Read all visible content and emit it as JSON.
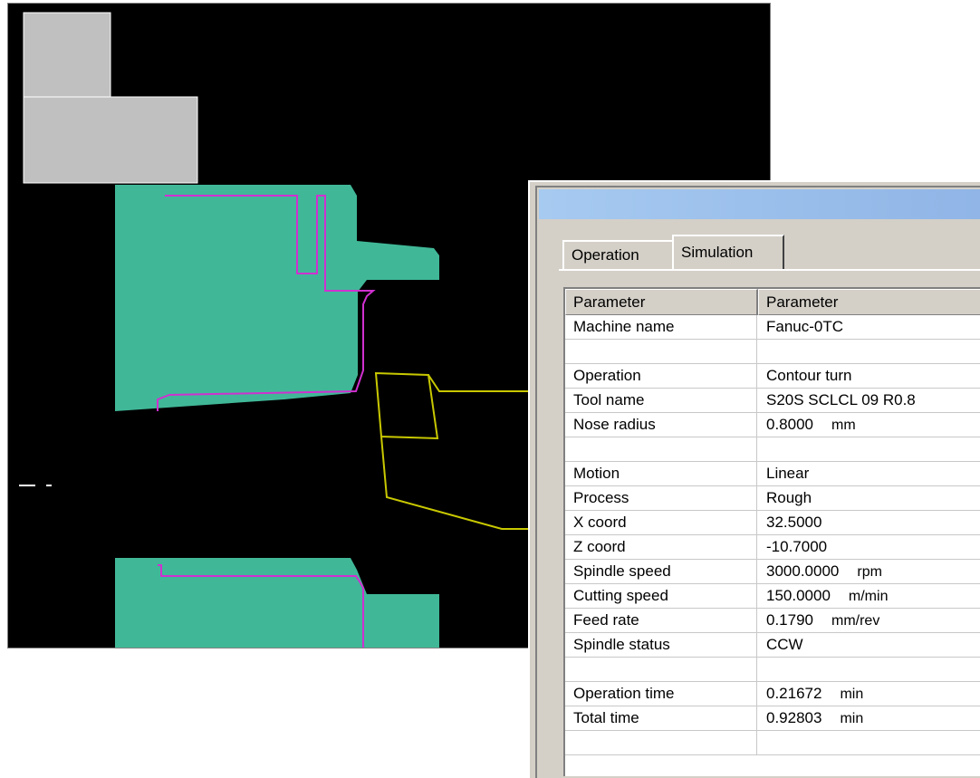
{
  "window": {
    "title": ""
  },
  "tabs": [
    {
      "label": "Operation",
      "active": false
    },
    {
      "label": "Simulation",
      "active": true
    }
  ],
  "table": {
    "headers": [
      "Parameter",
      "Parameter"
    ],
    "rows": [
      {
        "name": "Machine name",
        "value": "Fanuc-0TC",
        "unit": ""
      },
      {
        "name": "",
        "value": "",
        "unit": ""
      },
      {
        "name": "Operation",
        "value": "Contour turn",
        "unit": ""
      },
      {
        "name": "Tool name",
        "value": "S20S SCLCL 09 R0.8",
        "unit": ""
      },
      {
        "name": "Nose radius",
        "value": "0.8000",
        "unit": "mm"
      },
      {
        "name": "",
        "value": "",
        "unit": ""
      },
      {
        "name": "Motion",
        "value": "Linear",
        "unit": ""
      },
      {
        "name": "Process",
        "value": "Rough",
        "unit": ""
      },
      {
        "name": "X coord",
        "value": "32.5000",
        "unit": ""
      },
      {
        "name": "Z coord",
        "value": "-10.7000",
        "unit": ""
      },
      {
        "name": "Spindle speed",
        "value": "3000.0000",
        "unit": "rpm"
      },
      {
        "name": "Cutting speed",
        "value": "150.0000",
        "unit": "m/min"
      },
      {
        "name": "Feed rate",
        "value": "0.1790",
        "unit": "mm/rev"
      },
      {
        "name": "Spindle status",
        "value": "CCW",
        "unit": ""
      },
      {
        "name": "",
        "value": "",
        "unit": ""
      },
      {
        "name": "Operation time",
        "value": "0.21672",
        "unit": "min"
      },
      {
        "name": "Total time",
        "value": "0.92803",
        "unit": "min"
      },
      {
        "name": "",
        "value": "",
        "unit": ""
      }
    ]
  },
  "colors": {
    "viewport_bg": "#000000",
    "chuck": "#c0c0c0",
    "workpiece": "#40b898",
    "contour": "#d030d0",
    "tool": "#c8c800"
  }
}
